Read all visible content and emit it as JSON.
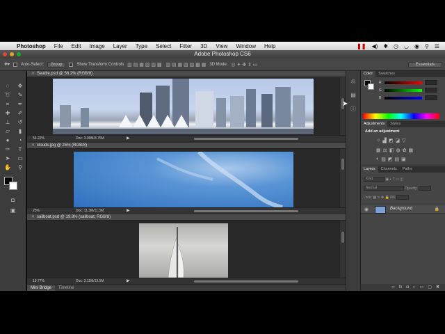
{
  "menubar": {
    "app": "Photoshop",
    "items": [
      "File",
      "Edit",
      "Image",
      "Layer",
      "Type",
      "Select",
      "Filter",
      "3D",
      "View",
      "Window",
      "Help"
    ]
  },
  "window": {
    "title": "Adobe Photoshop CS6"
  },
  "options": {
    "auto_select": "Auto-Select:",
    "group": "Group",
    "show_transform": "Show Transform Controls",
    "mode_3d": "3D Mode:",
    "workspace": "Essentials"
  },
  "docs": [
    {
      "tab": "Seattle.psd @ 56.2% (RGB/8)",
      "zoom": "56.22%",
      "info": "Doc: 3.09M/3.75M"
    },
    {
      "tab": "clouds.jpg @ 25% (RGB/8)",
      "zoom": "25%",
      "info": "Doc: 11.3M/11.3M"
    },
    {
      "tab": "sailboat.psd @ 19.8% (sailboat, RGB/8)",
      "zoom": "19.77%",
      "info": "Doc: 3.11M/13.5M"
    }
  ],
  "bottom_tabs": [
    "Mini Bridge",
    "Timeline"
  ],
  "panels": {
    "color_tabs": [
      "Color",
      "Swatches"
    ],
    "sliders": [
      "R",
      "G",
      "B"
    ],
    "adj_tabs": [
      "Adjustments",
      "Styles"
    ],
    "adj_title": "Add an adjustment",
    "layers_tabs": [
      "Layers",
      "Channels",
      "Paths"
    ],
    "kind": "Kind",
    "blend": "Normal",
    "opacity": "Opacity:",
    "lock": "Lock:",
    "fill": "Fill:",
    "layer_name": "Background"
  }
}
